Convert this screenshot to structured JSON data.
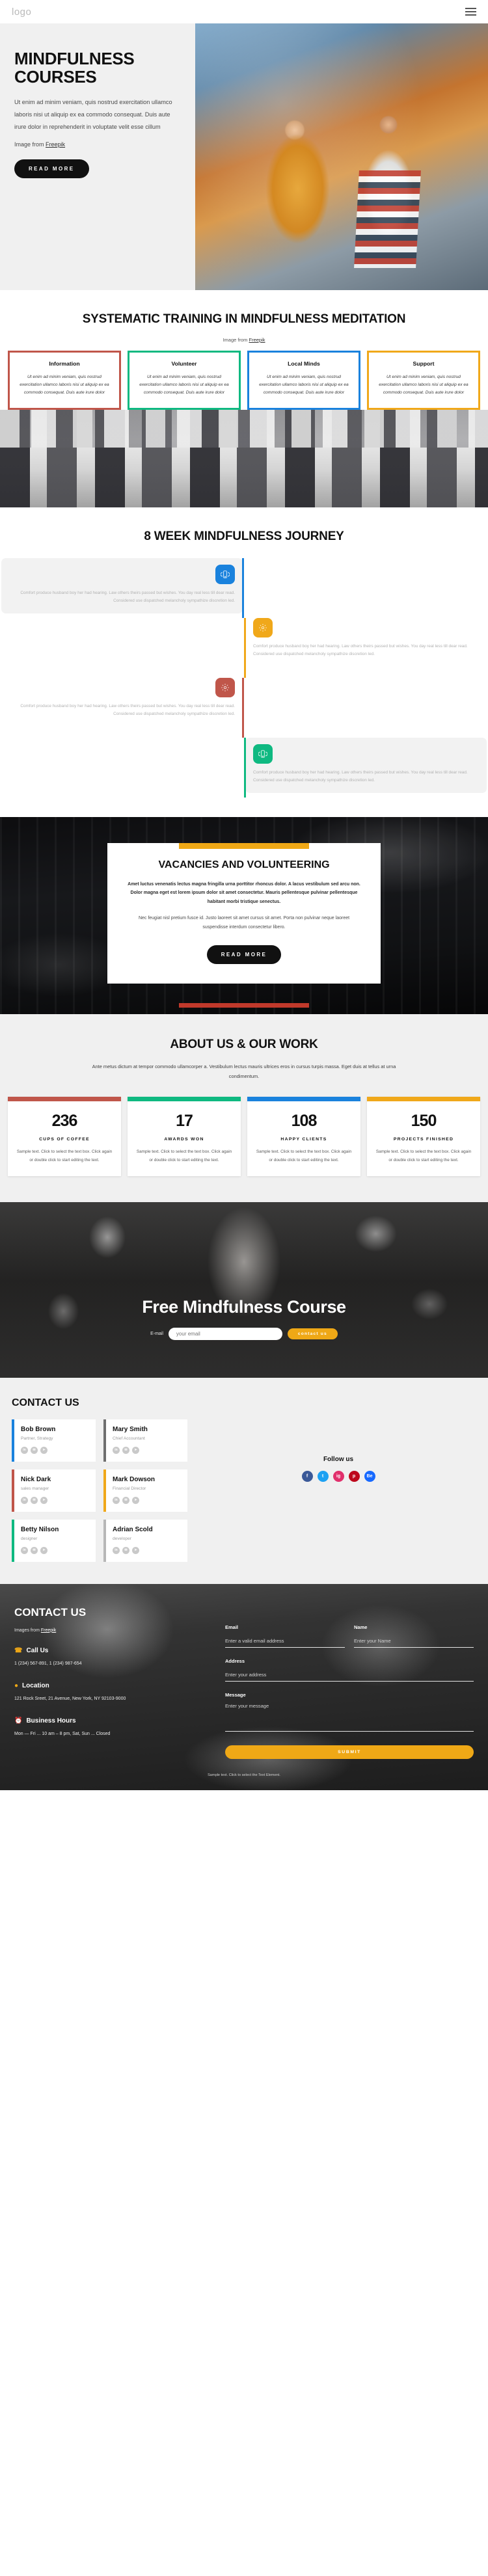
{
  "nav": {
    "logo": "logo",
    "menu_icon": "hamburger-icon"
  },
  "hero": {
    "title": "MINDFULNESS COURSES",
    "paragraph": "Ut enim ad minim veniam, quis nostrud exercitation ullamco laboris nisi ut aliquip ex ea commodo consequat. Duis aute irure dolor in reprehenderit in voluptate velit esse cillum",
    "credit_prefix": "Image from",
    "credit_link": "Freepik",
    "button": "READ MORE"
  },
  "training": {
    "heading": "SYSTEMATIC TRAINING IN MINDFULNESS MEDITATION",
    "credit_prefix": "Image from",
    "credit_link": "Freepik",
    "cards": [
      {
        "title": "Information",
        "text": "Ut enim ad minim veniam, quis nostrud exercitation ullamco laboris nisi ut aliquip ex ea commodo consequat. Duis aute irure dolor",
        "color": "#c0564a"
      },
      {
        "title": "Volunteer",
        "text": "Ut enim ad minim veniam, quis nostrud exercitation ullamco laboris nisi ut aliquip ex ea commodo consequat. Duis aute irure dolor",
        "color": "#0fb981"
      },
      {
        "title": "Local Minds",
        "text": "Ut enim ad minim veniam, quis nostrud exercitation ullamco laboris nisi ut aliquip ex ea commodo consequat. Duis aute irure dolor",
        "color": "#1a82dd"
      },
      {
        "title": "Support",
        "text": "Ut enim ad minim veniam, quis nostrud exercitation ullamco laboris nisi ut aliquip ex ea commodo consequat. Duis aute irure dolor",
        "color": "#f0a81a"
      }
    ]
  },
  "journey": {
    "heading": "8 WEEK MINDFULNESS JOURNEY",
    "items": [
      {
        "text": "Comfort produce husband boy her had hearing. Law others theirs passed but wishes. You day real less till dear read. Considered use dispatched melancholy sympathize discretion led.",
        "color": "#1a82dd",
        "icon": "mobile-icon",
        "side": "left",
        "filled": true
      },
      {
        "text": "Comfort produce husband boy her had hearing. Law others theirs passed but wishes. You day real less till dear read. Considered use dispatched melancholy sympathize discretion led.",
        "color": "#f0a81a",
        "icon": "gear-icon",
        "side": "right",
        "filled": false
      },
      {
        "text": "Comfort produce husband boy her had hearing. Law others theirs passed but wishes. You day real less till dear read. Considered use dispatched melancholy sympathize discretion led.",
        "color": "#c0564a",
        "icon": "gear-icon",
        "side": "left",
        "filled": false
      },
      {
        "text": "Comfort produce husband boy her had hearing. Law others theirs passed but wishes. You day real less till dear read. Considered use dispatched melancholy sympathize discretion led.",
        "color": "#0fb981",
        "icon": "mobile-icon",
        "side": "right",
        "filled": true
      }
    ]
  },
  "vacancies": {
    "heading": "VACANCIES AND VOLUNTEERING",
    "paragraph_bold": "Amet luctus venenatis lectus magna fringilla urna porttitor rhoncus dolor. A lacus vestibulum sed arcu non. Dolor magna eget est lorem ipsum dolor sit amet consectetur. Mauris pellentesque pulvinar pellentesque habitant morbi tristique senectus.",
    "paragraph": "Nec feugiat nisl pretium fusce id. Justo laoreet sit amet cursus sit amet. Porta non pulvinar neque laoreet suspendisse interdum consectetur libero.",
    "button": "READ MORE",
    "accent_top": "#efa816",
    "accent_bottom": "#c0392b"
  },
  "about": {
    "heading": "ABOUT US & OUR WORK",
    "lead": "Ante metus dictum at tempor commodo ullamcorper a. Vestibulum lectus mauris ultrices eros in cursus turpis massa. Eget duis at tellus at urna condimentum.",
    "stats": [
      {
        "number": "236",
        "label": "CUPS OF COFFEE",
        "text": "Sample text. Click to select the text box. Click again or double click to start editing the text.",
        "color": "#c0564a"
      },
      {
        "number": "17",
        "label": "AWARDS WON",
        "text": "Sample text. Click to select the text box. Click again or double click to start editing the text.",
        "color": "#0fb981"
      },
      {
        "number": "108",
        "label": "HAPPY CLIENTS",
        "text": "Sample text. Click to select the text box. Click again or double click to start editing the text.",
        "color": "#1a82dd"
      },
      {
        "number": "150",
        "label": "PROJECTS FINISHED",
        "text": "Sample text. Click to select the text box. Click again or double click to start editing the text.",
        "color": "#f0a81a"
      }
    ]
  },
  "cta": {
    "title": "Free Mindfulness Course",
    "field_label": "E-mail",
    "email_placeholder": "your email",
    "button": "contact us"
  },
  "team": {
    "heading": "CONTACT US",
    "follow_heading": "Follow us",
    "members": [
      {
        "name": "Bob Brown",
        "role": "Partner, Strategy",
        "color": "#1a82dd"
      },
      {
        "name": "Mary Smith",
        "role": "Chief Accountant",
        "color": "#6f6f6f"
      },
      {
        "name": "Nick Dark",
        "role": "sales manager",
        "color": "#c0564a"
      },
      {
        "name": "Mark Dowson",
        "role": "Financial Director",
        "color": "#f0a81a"
      },
      {
        "name": "Betty Nilson",
        "role": "designer",
        "color": "#0fb981"
      },
      {
        "name": "Adrian Scold",
        "role": "developer",
        "color": "#b7b7b7"
      }
    ],
    "member_socials": [
      "in",
      "mail",
      "send"
    ],
    "follow_socials": [
      {
        "name": "facebook",
        "glyph": "f",
        "color": "#3b5998"
      },
      {
        "name": "twitter",
        "glyph": "t",
        "color": "#1da1f2"
      },
      {
        "name": "instagram",
        "glyph": "ig",
        "color": "#e1306c"
      },
      {
        "name": "pinterest",
        "glyph": "p",
        "color": "#bd081c"
      },
      {
        "name": "behance",
        "glyph": "Be",
        "color": "#1769ff"
      }
    ]
  },
  "footer": {
    "heading": "CONTACT US",
    "credit_prefix": "Images from",
    "credit_link": "Freepik",
    "call_title": "Call Us",
    "call_text": "1 (234) 567-891, 1 (234) 987-654",
    "location_title": "Location",
    "location_text": "121 Rock Sreet, 21 Avenue, New York, NY 92103-9000",
    "hours_title": "Business Hours",
    "hours_text": "Mon — Fri ... 10 am – 8 pm, Sat, Sun ... Closed",
    "form": {
      "email_label": "Email",
      "email_placeholder": "Enter a valid email address",
      "name_label": "Name",
      "name_placeholder": "Enter your Name",
      "address_label": "Address",
      "address_placeholder": "Enter your address",
      "message_label": "Message",
      "message_placeholder": "Enter your message",
      "submit": "SUBMIT"
    },
    "note": "Sample text. Click to select the Text Element."
  }
}
